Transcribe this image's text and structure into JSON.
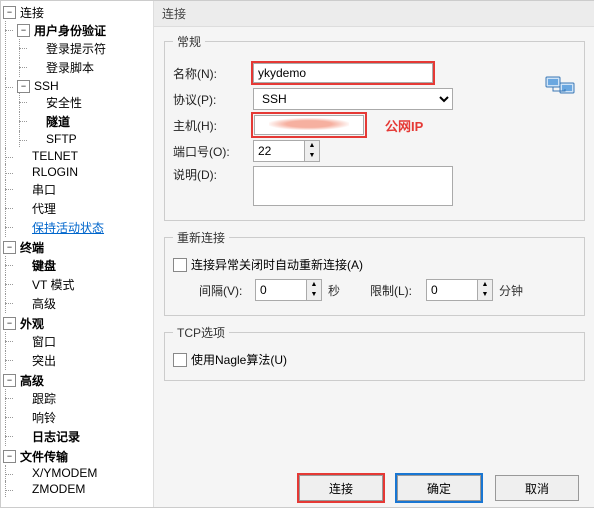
{
  "title": "连接",
  "sidebar": {
    "root": "连接",
    "groups": [
      {
        "label": "用户身份验证",
        "bold": true,
        "children": [
          {
            "label": "登录提示符"
          },
          {
            "label": "登录脚本"
          }
        ]
      },
      {
        "label": "SSH",
        "children": [
          {
            "label": "安全性"
          },
          {
            "label": "隧道",
            "bold": true
          },
          {
            "label": "SFTP"
          }
        ]
      },
      {
        "label": "TELNET"
      },
      {
        "label": "RLOGIN"
      },
      {
        "label": "串口"
      },
      {
        "label": "代理"
      },
      {
        "label": "保持活动状态",
        "link": true
      }
    ],
    "extra_groups": [
      {
        "label": "终端",
        "children": [
          {
            "label": "键盘",
            "bold": true
          },
          {
            "label": "VT 模式"
          },
          {
            "label": "高级"
          }
        ]
      },
      {
        "label": "外观",
        "children": [
          {
            "label": "窗口"
          },
          {
            "label": "突出"
          }
        ]
      },
      {
        "label": "高级",
        "children": [
          {
            "label": "跟踪"
          },
          {
            "label": "响铃"
          },
          {
            "label": "日志记录",
            "bold": true
          }
        ]
      },
      {
        "label": "文件传输",
        "children": [
          {
            "label": "X/YMODEM"
          },
          {
            "label": "ZMODEM"
          }
        ]
      }
    ]
  },
  "general": {
    "legend": "常规",
    "name_label": "名称(N):",
    "name_value": "ykydemo",
    "proto_label": "协议(P):",
    "proto_value": "SSH",
    "host_label": "主机(H):",
    "host_value": "",
    "host_annotation": "公网IP",
    "port_label": "端口号(O):",
    "port_value": "22",
    "desc_label": "说明(D):",
    "desc_value": ""
  },
  "reconnect": {
    "legend": "重新连接",
    "auto_label": "连接异常关闭时自动重新连接(A)",
    "interval_label": "间隔(V):",
    "interval_value": "0",
    "interval_unit": "秒",
    "limit_label": "限制(L):",
    "limit_value": "0",
    "limit_unit": "分钟"
  },
  "tcp": {
    "legend": "TCP选项",
    "nagle_label": "使用Nagle算法(U)"
  },
  "buttons": {
    "connect": "连接",
    "ok": "确定",
    "cancel": "取消"
  }
}
